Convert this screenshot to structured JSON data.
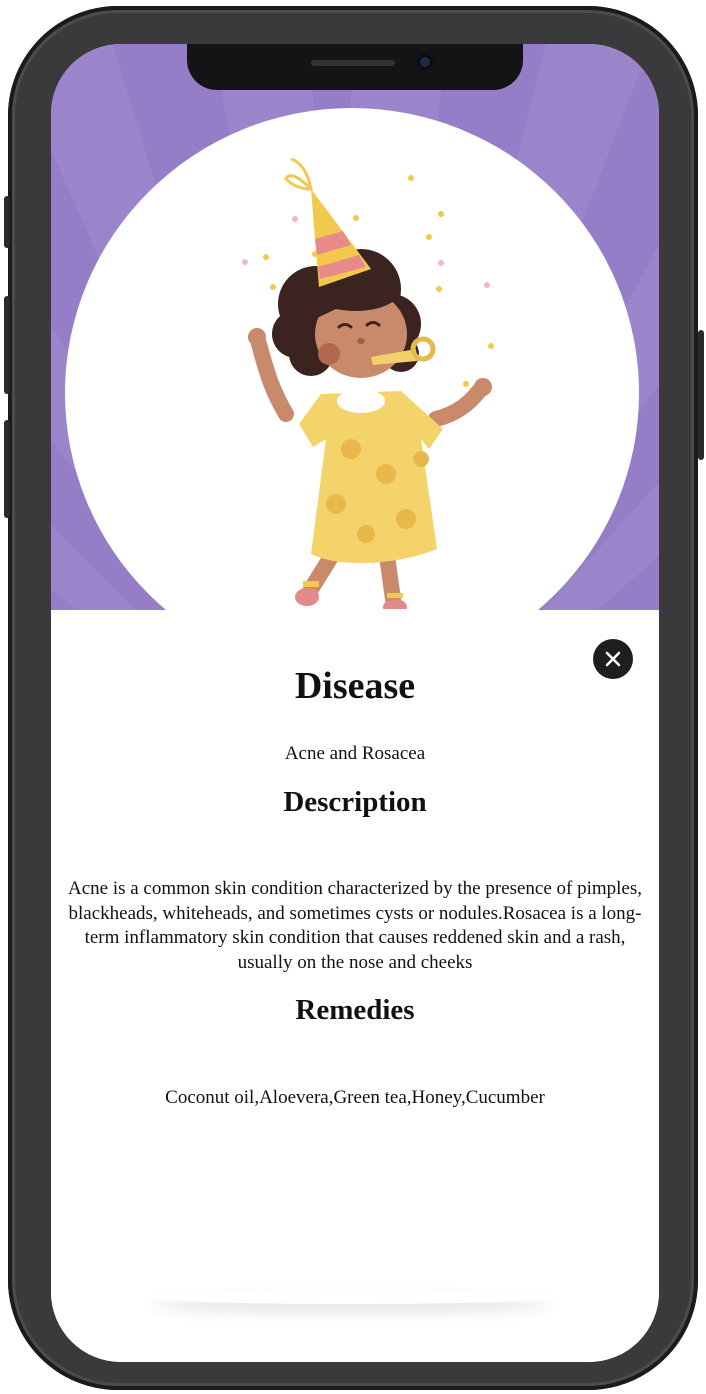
{
  "colors": {
    "hero_background": "#957dc8",
    "close_button": "#1e1e1e",
    "phone_frame": "#3a3a3c"
  },
  "icons": {
    "close": "close-icon"
  },
  "illustration": "girl-in-party-hat-blowing-party-horn",
  "disease": {
    "heading": "Disease",
    "value": "Acne and Rosacea"
  },
  "description": {
    "heading": "Description",
    "text": "Acne is a common skin condition characterized by the presence of pimples, blackheads, whiteheads, and sometimes cysts or nodules.Rosacea is a long-term inflammatory skin condition that causes reddened skin and a rash, usually on the nose and cheeks"
  },
  "remedies": {
    "heading": "Remedies",
    "text": "Coconut oil,Aloevera,Green tea,Honey,Cucumber"
  }
}
